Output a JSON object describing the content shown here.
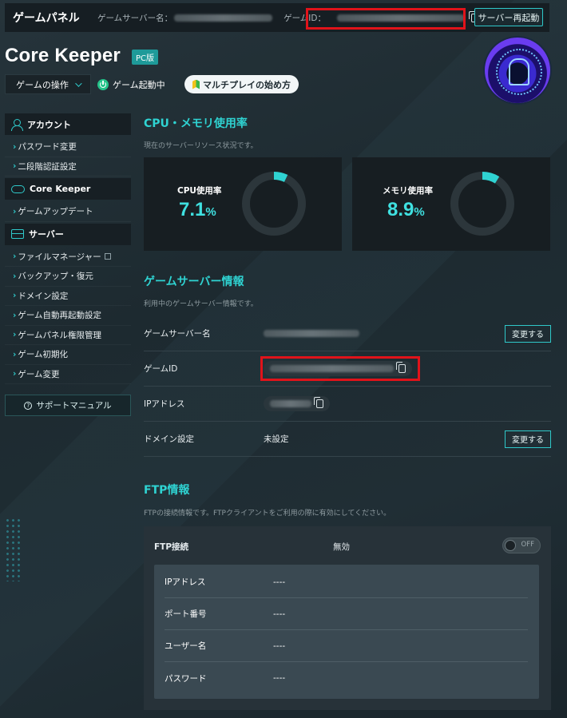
{
  "topbar": {
    "brand": "ゲームパネル",
    "server_name_label": "ゲームサーバー名：",
    "game_id_label": "ゲームID：",
    "restart_button": "サーバー再起動"
  },
  "header": {
    "game_title": "Core Keeper",
    "platform_badge": "PC版",
    "game_ops_select": "ゲームの操作",
    "status": "ゲーム起動中",
    "multiplayer_button": "マルチプレイの始め方"
  },
  "sidebar": {
    "sections": [
      {
        "title": "アカウント",
        "icon": "user-icon",
        "items": [
          "パスワード変更",
          "二段階認証設定"
        ]
      },
      {
        "title": "Core Keeper",
        "icon": "gamepad-icon",
        "items": [
          "ゲームアップデート"
        ]
      },
      {
        "title": "サーバー",
        "icon": "server-icon",
        "items": [
          "ファイルマネージャー",
          "バックアップ・復元",
          "ドメイン設定",
          "ゲーム自動再起動設定",
          "ゲームパネル権限管理",
          "ゲーム初期化",
          "ゲーム変更"
        ]
      }
    ],
    "support_button": "サポートマニュアル"
  },
  "usage": {
    "title": "CPU・メモリ使用率",
    "subtitle": "現在のサーバーリソース状況です。",
    "cpu": {
      "label": "CPU使用率",
      "value": "7.1",
      "unit": "%",
      "fraction": 0.071
    },
    "memory": {
      "label": "メモリ使用率",
      "value": "8.9",
      "unit": "%",
      "fraction": 0.089
    },
    "accent": "#2fd3d2"
  },
  "server_info": {
    "title": "ゲームサーバー情報",
    "subtitle": "利用中のゲームサーバー情報です。",
    "rows": {
      "server_name": {
        "label": "ゲームサーバー名",
        "button": "変更する"
      },
      "game_id": {
        "label": "ゲームID"
      },
      "ip": {
        "label": "IPアドレス"
      },
      "domain": {
        "label": "ドメイン設定",
        "value": "未設定",
        "button": "変更する"
      }
    }
  },
  "ftp": {
    "title": "FTP情報",
    "subtitle": "FTPの接続情報です。FTPクライアントをご利用の際に有効にしてください。",
    "connection_label": "FTP接続",
    "connection_value": "無効",
    "toggle_label": "OFF",
    "rows": [
      {
        "label": "IPアドレス",
        "value": "----"
      },
      {
        "label": "ポート番号",
        "value": "----"
      },
      {
        "label": "ユーザー名",
        "value": "----"
      },
      {
        "label": "パスワード",
        "value": "----"
      }
    ]
  }
}
